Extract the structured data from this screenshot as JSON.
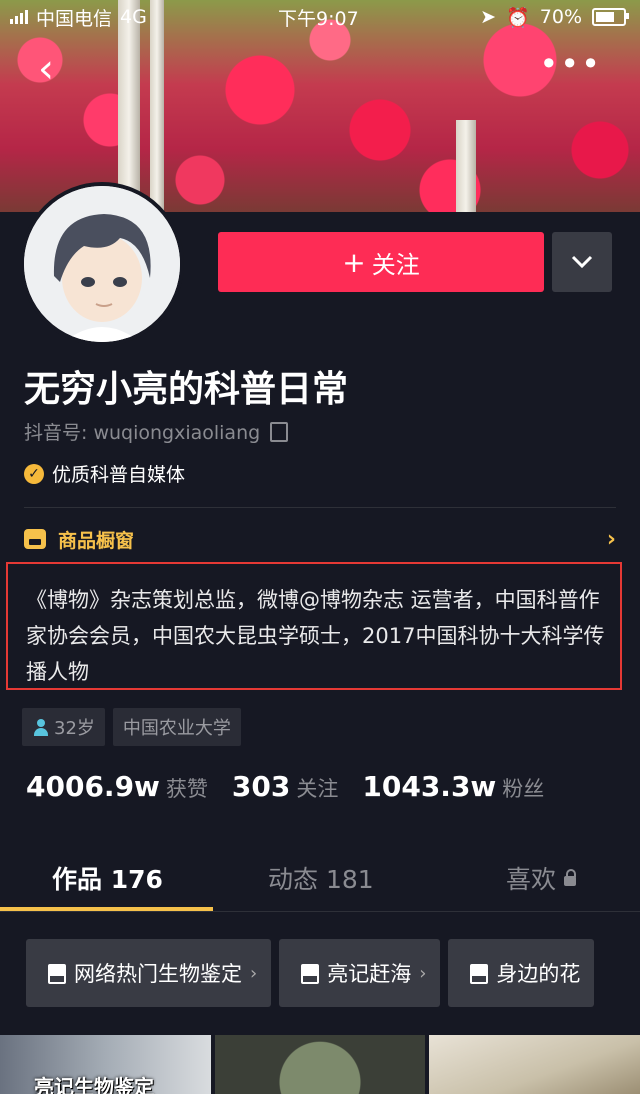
{
  "status_bar": {
    "carrier": "中国电信",
    "network": "4G",
    "time": "下午9:07",
    "battery": "70%"
  },
  "profile": {
    "follow_label": "关注",
    "name": "无穷小亮的科普日常",
    "douyin_id": "抖音号: wuqiongxiaoliang",
    "verified_label": "优质科普自媒体",
    "shop_label": "商品橱窗",
    "bio": "《博物》杂志策划总监，微博@博物杂志 运营者，中国科普作家协会会员，中国农大昆虫学硕士，2017中国科协十大科学传播人物",
    "tags": [
      "32岁",
      "中国农业大学"
    ]
  },
  "stats": [
    {
      "value": "4006.9w",
      "label": "获赞"
    },
    {
      "value": "303",
      "label": "关注"
    },
    {
      "value": "1043.3w",
      "label": "粉丝"
    }
  ],
  "tabs": [
    {
      "label": "作品 176"
    },
    {
      "label": "动态 181"
    },
    {
      "label": "喜欢"
    }
  ],
  "collections": [
    {
      "label": "网络热门生物鉴定"
    },
    {
      "label": "亮记赶海"
    },
    {
      "label": "身边的花"
    }
  ],
  "thumbnails": [
    {
      "caption": "亮记生物鉴定"
    }
  ],
  "colors": {
    "background": "#161823",
    "accent": "#fe2c55",
    "highlight": "#f6c14b"
  }
}
